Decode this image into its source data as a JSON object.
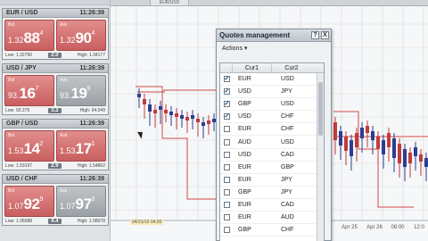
{
  "tiles": [
    {
      "pair": "EUR / USD",
      "time": "11:26:39",
      "sell": {
        "label": "Bid",
        "small": "1.32",
        "big": "88",
        "sup": "4",
        "color": "red"
      },
      "buy": {
        "label": "Ask",
        "small": "1.32",
        "big": "90",
        "sup": "4",
        "color": "red"
      },
      "low": "Low: 1.32766",
      "spread": "2.0",
      "high": "High: 1.34177"
    },
    {
      "pair": "USD / JPY",
      "time": "11:26:39",
      "sell": {
        "label": "Bid",
        "small": "93.",
        "big": "16",
        "sup": "7",
        "color": "red"
      },
      "buy": {
        "label": "Ask",
        "small": "93.",
        "big": "19",
        "sup": "9",
        "color": "grey"
      },
      "low": "Low: 93.276",
      "spread": "3.2",
      "high": "High: 94.049"
    },
    {
      "pair": "GBP / USD",
      "time": "11:26:39",
      "sell": {
        "label": "Bid",
        "small": "1.53",
        "big": "14",
        "sup": "2",
        "color": "red"
      },
      "buy": {
        "label": "Ask",
        "small": "1.53",
        "big": "17",
        "sup": "1",
        "color": "red"
      },
      "low": "Low: 1.53197",
      "spread": "2.9",
      "high": "High: 1.54862"
    },
    {
      "pair": "USD / CHF",
      "time": "11:26:39",
      "sell": {
        "label": "Bid",
        "small": "1.07",
        "big": "92",
        "sup": "9",
        "color": "red"
      },
      "buy": {
        "label": "Ask",
        "small": "1.07",
        "big": "97",
        "sup": "3",
        "color": "grey"
      },
      "low": "Low: 1.06988",
      "spread": "4.4",
      "high": "High: 1.08078"
    }
  ],
  "chart": {
    "tab_label": "EUR/USD",
    "time_label": "04/21/10 04:00",
    "x_labels": [
      "Apr 25",
      "Apr 26",
      "08:00",
      "12:0"
    ]
  },
  "dialog": {
    "title": "Quotes management",
    "help_label": "?",
    "close_label": "X",
    "actions_label": "Actions ▾",
    "col1": "Cur1",
    "col2": "Cur2",
    "rows": [
      {
        "cur1": "EUR",
        "cur2": "USD",
        "checked": true
      },
      {
        "cur1": "USD",
        "cur2": "JPY",
        "checked": true
      },
      {
        "cur1": "GBP",
        "cur2": "USD",
        "checked": true
      },
      {
        "cur1": "USD",
        "cur2": "CHF",
        "checked": true
      },
      {
        "cur1": "EUR",
        "cur2": "CHF",
        "checked": false
      },
      {
        "cur1": "AUD",
        "cur2": "USD",
        "checked": false
      },
      {
        "cur1": "USD",
        "cur2": "CAD",
        "checked": false
      },
      {
        "cur1": "EUR",
        "cur2": "GBP",
        "checked": false
      },
      {
        "cur1": "EUR",
        "cur2": "JPY",
        "checked": false
      },
      {
        "cur1": "GBP",
        "cur2": "JPY",
        "checked": false
      },
      {
        "cur1": "EUR",
        "cur2": "CAD",
        "checked": false
      },
      {
        "cur1": "EUR",
        "cur2": "AUD",
        "checked": false
      },
      {
        "cur1": "GBP",
        "cur2": "CHF",
        "checked": false
      }
    ]
  },
  "colors": {
    "bid_red": "#c95f5f",
    "neutral_grey": "#9aa0a5",
    "candle_up": "#2c3e8f",
    "candle_down": "#c23b3b"
  }
}
